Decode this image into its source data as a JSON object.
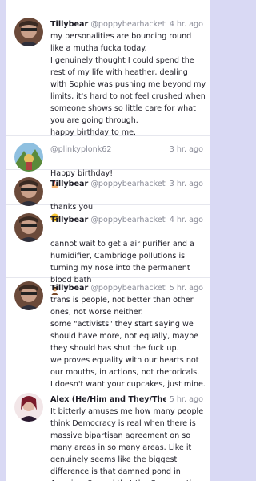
{
  "posts": [
    {
      "name": "Tillybear",
      "handle": "@poppybearhackett75",
      "time": "4 hr. ago",
      "text": "my personalities are bouncing round like a mutha fucka today.\nI genuinely thought I could spend the rest of my life with heather, dealing with Sophie was pushing me beyond my limits, it's hard to not feel crushed when someone shows so little care for what you are going through.\nhappy birthday to me.",
      "avatar_icon": "user-avatar"
    },
    {
      "name": "",
      "handle": "@plinkyplonk62",
      "time": "3 hr. ago",
      "text": "Happy birthday!",
      "emoji": "cake",
      "avatar_icon": "user-avatar"
    },
    {
      "name": "Tillybear",
      "handle": "@poppybearhackett75",
      "time": "3 hr. ago",
      "text": "thanks you",
      "emoji": "smiley",
      "avatar_icon": "user-avatar"
    },
    {
      "name": "Tillybear",
      "handle": "@poppybearhackett75",
      "time": "4 hr. ago",
      "text": "cannot wait to get a air purifier and a humidifier, Cambridge pollutions is turning my nose into the permanent blood bath",
      "emoji": "person-facepalm",
      "avatar_icon": "user-avatar"
    },
    {
      "name": "Tillybear",
      "handle": "@poppybearhackett75",
      "time": "5 hr. ago",
      "text": "trans is people, not better than other ones, not worse neither.\nsome \"activists\" they start saying we should have more, not equally, maybe they should has shut the fuck up.\nwe proves equality with our hearts not our mouths, in actions, not rhetoricals.\nI doesn't want your cupcakes, just mine.",
      "avatar_icon": "user-avatar"
    },
    {
      "name": "Alex (He/Him and They/Them)",
      "handle": "@",
      "time": "5 hr. ago",
      "text": "It bitterly amuses me how many people think Democracy is real when there is massive bipartisan agreement on so many areas in so many areas. Like it genuinely seems like the biggest difference is that damned pond in America. Oh and that the Conservatives",
      "avatar_icon": "user-avatar"
    }
  ],
  "colors": {
    "background": "#d9d9f4",
    "card": "#ffffff",
    "text": "#1d1c26",
    "muted": "#8a8c98"
  }
}
